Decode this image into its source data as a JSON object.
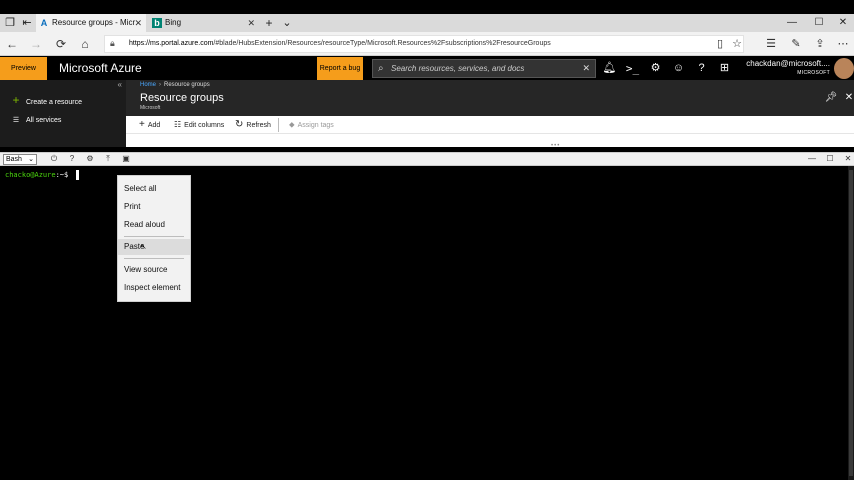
{
  "browser": {
    "tabs": [
      {
        "title": "Resource groups - Micr",
        "icon": "azure-icon",
        "active": true
      },
      {
        "title": "Bing",
        "icon": "bing-icon",
        "active": false
      }
    ],
    "new_tab_symbol": "+",
    "tab_list_symbol": "⌄",
    "url_host": "https://ms.portal.azure.com",
    "url_path": "/#blade/HubsExtension/Resources/resourceType/Microsoft.Resources%2Fsubscriptions%2FresourceGroups"
  },
  "portal": {
    "preview_label": "Preview",
    "brand": "Microsoft Azure",
    "report_bug_label": "Report a bug",
    "search_placeholder": "Search resources, services, and docs",
    "user_name": "chackdan@microsoft....",
    "user_org": "MICROSOFT"
  },
  "sidebar": {
    "collapse_symbol": "«",
    "items": [
      {
        "label": "Create a resource",
        "icon": "plus-icon"
      },
      {
        "label": "All services",
        "icon": "list-icon"
      }
    ]
  },
  "blade": {
    "breadcrumb": [
      "Home",
      "Resource groups"
    ],
    "title": "Resource groups",
    "subtitle": "Microsoft",
    "toolbar": {
      "add": "Add",
      "edit_columns": "Edit columns",
      "refresh": "Refresh",
      "assign_tags": "Assign tags"
    }
  },
  "shell": {
    "shell_type": "Bash",
    "prompt_user": "chacko@Azure",
    "prompt_symbol": ":~$"
  },
  "context_menu": {
    "items": [
      "Select all",
      "Print",
      "Read aloud",
      "Paste",
      "View source",
      "Inspect element"
    ],
    "hovered": "Paste"
  },
  "colors": {
    "accent_orange": "#f59d1b",
    "prompt_green": "#4bd60e",
    "link_blue": "#4aa8ff",
    "create_plus_green": "#7fba00"
  }
}
